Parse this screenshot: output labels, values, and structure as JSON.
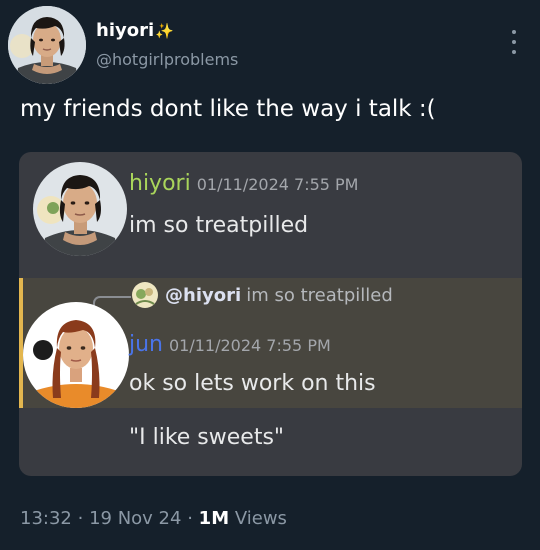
{
  "author": {
    "name": "hiyori",
    "badge_glyph": "✨",
    "handle": "@hotgirlproblems"
  },
  "more_icon": "more-horizontal-dots-icon",
  "tweet": {
    "text": "my friends dont like the way i talk :("
  },
  "discord": {
    "message1": {
      "username": "hiyori",
      "username_color": "#a9d55b",
      "time": "01/11/2024 7:55 PM",
      "text": "im so treatpilled"
    },
    "reply": {
      "mention": "@hiyori",
      "text": "im so treatpilled"
    },
    "message2": {
      "username": "jun",
      "username_color": "#4a74e8",
      "time": "01/11/2024 7:55 PM",
      "text": "ok so lets work on this"
    },
    "message3": {
      "text": "\"I like sweets\""
    },
    "highlight_color": "#e3b64f"
  },
  "meta": {
    "time": "13:32",
    "sep1": "·",
    "date": "19 Nov 24",
    "sep2": "·",
    "views": "1M",
    "views_label": "Views"
  }
}
